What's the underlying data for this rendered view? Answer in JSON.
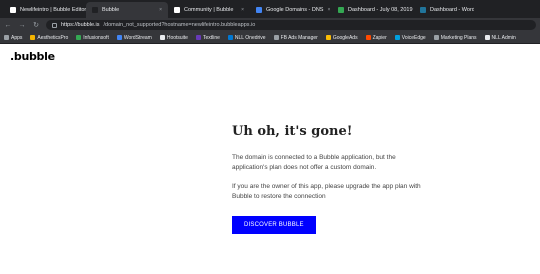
{
  "browser": {
    "tabs": [
      {
        "title": "Newlifeintro | Bubble Editor",
        "favicon_color": "#ffffff",
        "active": false
      },
      {
        "title": "Bubble",
        "favicon_color": "#202124",
        "active": true
      },
      {
        "title": "Community | Bubble",
        "favicon_color": "#ffffff",
        "active": false
      },
      {
        "title": "Google Domains - DNS",
        "favicon_color": "#4285f4",
        "active": false
      },
      {
        "title": "Dashboard - July 08, 2019",
        "favicon_color": "#34a853",
        "active": false
      },
      {
        "title": "Dashboard - WordP",
        "favicon_color": "#21759b",
        "active": false
      }
    ],
    "tab_close_glyph": "×",
    "nav": {
      "back": "←",
      "forward": "→",
      "reload": "↻"
    },
    "url": {
      "host": "https://bubble.is",
      "path": "/domain_not_supported?hostname=newlifeintro.bubbleapps.io"
    },
    "bookmarks": [
      {
        "label": "Apps",
        "icon_color": "#9aa0a6"
      },
      {
        "label": "AestheticsPro",
        "icon_color": "#f4b400"
      },
      {
        "label": "Infusionsoft",
        "icon_color": "#34a853"
      },
      {
        "label": "WordStream",
        "icon_color": "#4285f4"
      },
      {
        "label": "Hootsuite",
        "icon_color": "#e8eaed"
      },
      {
        "label": "Textline",
        "icon_color": "#673ab7"
      },
      {
        "label": "NLL Onedrive",
        "icon_color": "#0078d4"
      },
      {
        "label": "FB Ads Manager",
        "icon_color": "#9aa0a6"
      },
      {
        "label": "GoogleAds",
        "icon_color": "#fbbc05"
      },
      {
        "label": "Zapier",
        "icon_color": "#ff4a00"
      },
      {
        "label": "VoiceEdge",
        "icon_color": "#00a1e0"
      },
      {
        "label": "Marketing Plans",
        "icon_color": "#9aa0a6"
      },
      {
        "label": "NLL Admin",
        "icon_color": "#e8eaed"
      }
    ]
  },
  "page": {
    "logo": ".bubble",
    "headline": "Uh oh, it's gone!",
    "paragraph_1": "The domain  is connected to a Bubble application, but the application's plan does not offer a custom domain.",
    "paragraph_2": "If you are the owner of this app, please upgrade the app plan with Bubble to restore the connection",
    "cta_label": "DISCOVER BUBBLE",
    "cta_color": "#0000ff"
  }
}
